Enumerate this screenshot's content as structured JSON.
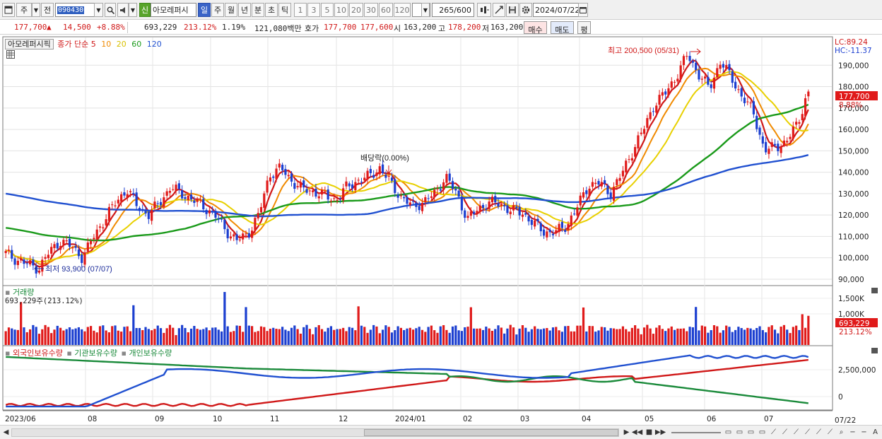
{
  "toolbar": {
    "period_type": "주",
    "prev_label": "전",
    "code": "090430",
    "new_badge": "신",
    "stock_name": "아모레퍼시",
    "timeframes": [
      "일",
      "주",
      "월",
      "년",
      "분",
      "초",
      "틱"
    ],
    "active_timeframe": "일",
    "intervals": [
      "1",
      "3",
      "5",
      "10",
      "20",
      "30",
      "60",
      "120"
    ],
    "interval_field": "",
    "count": "265",
    "count_max": "/600",
    "date": "2024/07/22"
  },
  "quote": {
    "price": "177,700",
    "arrow": "▲",
    "change": "14,500",
    "change_pct": "+8.88%",
    "volume": "693,229",
    "volume_pct": "213.12%",
    "turnover_pct": "1.19%",
    "amount": "121,080백만",
    "hoga_label": "호가",
    "ask": "177,700",
    "bid": "177,600",
    "open_label": "시",
    "open": "163,200",
    "high_label": "고",
    "high": "178,200",
    "low_label": "저",
    "low": "163,200",
    "buy_label": "매수",
    "sell_label": "매도",
    "eval_label": "평"
  },
  "price_panel": {
    "legend_name": "아모레퍼시픽",
    "legend_type": "종가 단순",
    "ma_labels": [
      "5",
      "10",
      "20",
      "60",
      "120"
    ],
    "ma_colors": [
      "#d01818",
      "#f08a00",
      "#e8d000",
      "#1a9a1a",
      "#2050d0"
    ],
    "lc": "LC:89.24",
    "hc": "HC:-11.37",
    "y_ticks": [
      "190,000",
      "180,000",
      "170,000",
      "160,000",
      "150,000",
      "140,000",
      "130,000",
      "120,000",
      "110,000",
      "100,000",
      "90,000"
    ],
    "current_price_label": "177,700",
    "current_pct_label": "8.88%",
    "high_annotation": "최고 200,500 (05/31)",
    "low_annotation": "최저 93,900 (07/07)",
    "dividend_annotation": "배당락(0.00%)"
  },
  "volume_panel": {
    "title": "거래량",
    "value_label": "693,229주(213.12%)",
    "y_ticks": [
      "1,500K",
      "1,000K"
    ],
    "current_label": "693,229",
    "current_pct": "213.12%"
  },
  "holding_panel": {
    "legend": [
      "외국인보유수량",
      "기관보유수량",
      "개인보유수량"
    ],
    "colors": [
      "#d01818",
      "#1a8a3a",
      "#2050d0"
    ],
    "y_ticks": [
      "2,500,000",
      "0"
    ]
  },
  "x_axis": {
    "labels": [
      "2023/06",
      "08",
      "09",
      "10",
      "11",
      "12",
      "2024/01",
      "02",
      "03",
      "04",
      "05",
      "06",
      "07"
    ],
    "right_label": "07/22"
  },
  "chart_data": {
    "type": "candlestick",
    "title": "아모레퍼시픽",
    "x_labels": [
      "2023/06",
      "08",
      "09",
      "10",
      "11",
      "12",
      "2024/01",
      "02",
      "03",
      "04",
      "05",
      "06",
      "07"
    ],
    "y_range": [
      90000,
      200000
    ],
    "closes": [
      102000,
      99000,
      97000,
      95000,
      103000,
      108000,
      105000,
      100000,
      110000,
      118000,
      126000,
      132000,
      124000,
      120000,
      126000,
      133000,
      130000,
      127000,
      124000,
      120000,
      113000,
      108000,
      111000,
      120000,
      139000,
      142000,
      136000,
      132000,
      131000,
      129000,
      127000,
      133000,
      136000,
      138000,
      142000,
      135000,
      128000,
      124000,
      126000,
      130000,
      138000,
      130000,
      118000,
      123000,
      126000,
      125000,
      122000,
      121000,
      116000,
      112000,
      112000,
      115000,
      124000,
      134000,
      135000,
      130000,
      139000,
      150000,
      160000,
      172000,
      177000,
      185000,
      195000,
      186000,
      179000,
      192000,
      184000,
      175000,
      168000,
      150000,
      152000,
      154000,
      163000,
      177700
    ],
    "open": "163,200",
    "high": "178,200",
    "low": "163,200",
    "last_close": "177,700",
    "period_high": {
      "value": 200500,
      "date": "05/31"
    },
    "period_low": {
      "value": 93900,
      "date": "07/07"
    },
    "moving_averages": [
      5,
      10,
      20,
      60,
      120
    ],
    "volume_last": "693,229",
    "volume_max_tick": "1,500K"
  }
}
